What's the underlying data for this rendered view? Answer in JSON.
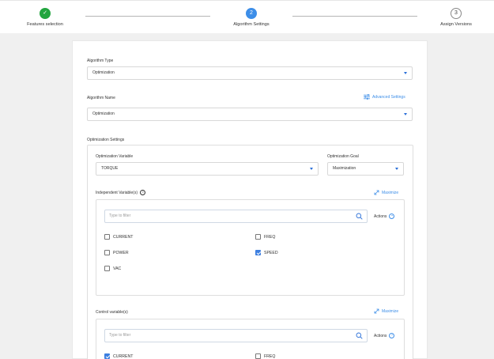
{
  "stepper": {
    "steps": [
      {
        "label": "Features selection",
        "marker": "✓",
        "state": "done"
      },
      {
        "label": "Algorithm Settings",
        "marker": "2",
        "state": "active"
      },
      {
        "label": "Assign Versions",
        "marker": "3",
        "state": "todo"
      }
    ]
  },
  "form": {
    "algorithm_type": {
      "label": "Algorithm Type",
      "value": "Optimization"
    },
    "algorithm_name": {
      "label": "Algorithm Name",
      "value": "Optimization"
    },
    "advanced_settings": "Advanced Settings",
    "optimization_settings": {
      "label": "Optimization Settings",
      "variable": {
        "label": "Optimization Variable",
        "value": "TORQUE"
      },
      "goal": {
        "label": "Optimization Goal",
        "value": "Maximization"
      },
      "independent": {
        "label": "Independent Variable(s)",
        "info": "i",
        "maximize": "Maximize",
        "filter_placeholder": "Type to filter",
        "actions": "Actions",
        "items": [
          {
            "label": "CURRENT",
            "checked": false
          },
          {
            "label": "FREQ",
            "checked": false
          },
          {
            "label": "POWER",
            "checked": false
          },
          {
            "label": "SPEED",
            "checked": true
          },
          {
            "label": "VAC",
            "checked": false
          }
        ]
      },
      "control": {
        "label": "Control variable(s)",
        "maximize": "Maximize",
        "filter_placeholder": "Type to filter",
        "actions": "Actions",
        "items": [
          {
            "label": "CURRENT",
            "checked": true
          },
          {
            "label": "FREQ",
            "checked": false
          }
        ]
      }
    }
  },
  "colors": {
    "accent": "#3d8ee8",
    "done": "#22a53f"
  }
}
